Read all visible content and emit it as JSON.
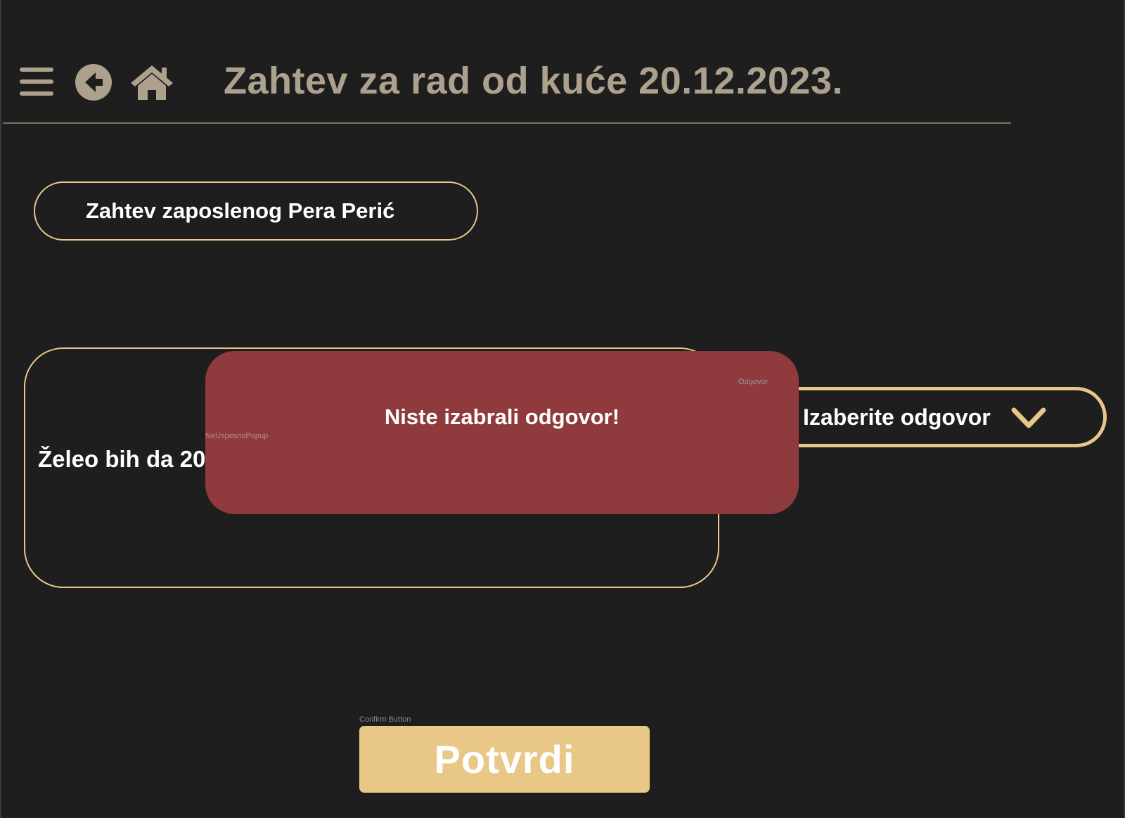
{
  "header": {
    "title": "Zahtev za rad od kuće 20.12.2023.",
    "icons": [
      "menu-icon",
      "back-icon",
      "home-icon"
    ]
  },
  "employee": {
    "label": "Zahtev zaposlenog Pera Perić"
  },
  "request": {
    "text": "Želeo bih da 20"
  },
  "answer": {
    "layer_label": "Odgovor",
    "placeholder": "Izaberite odgovor",
    "icon": "chevron-down-icon"
  },
  "popup": {
    "layer_label": "NeUspesnoPopup",
    "message": "Niste izabrali odgovor!"
  },
  "confirm": {
    "layer_label": "Confirm Button",
    "label": "Potvrdi"
  },
  "colors": {
    "background": "#1e1e1e",
    "accent": "#e7c68a",
    "title": "#ada18d",
    "error": "#8f3a3d",
    "button": "#e8c787"
  }
}
